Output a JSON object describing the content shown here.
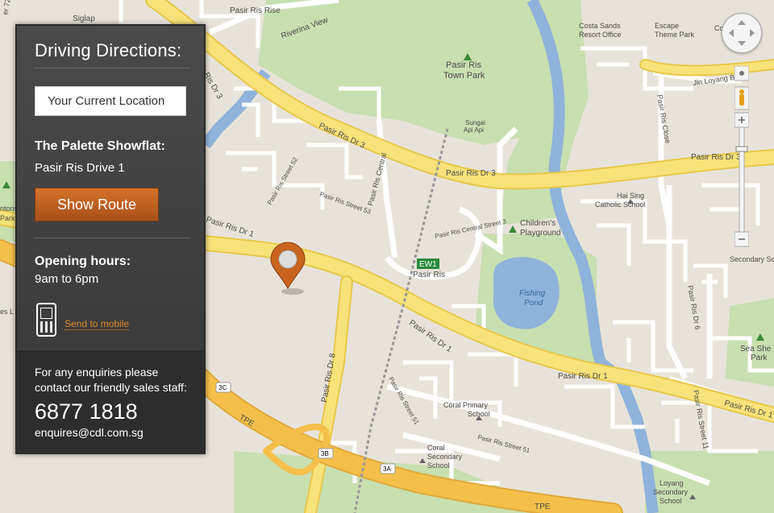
{
  "panel": {
    "title": "Driving Directions:",
    "location_input": "Your Current Location",
    "destination_title": "The Palette Showflat:",
    "destination_address": "Pasir Ris Drive 1",
    "route_button": "Show Route",
    "hours_title": "Opening hours:",
    "hours_value": "9am to 6pm",
    "send_link": "Send to mobile",
    "enquiry_line1": "For any enquiries please",
    "enquiry_line2": "contact our friendly sales staff:",
    "phone": "6877 1818",
    "email": "enquires@cdl.com.sg"
  },
  "map_labels": {
    "siglap": "Siglap",
    "riverina": "Riverina View",
    "pasir_ris_rise": "Pasir Ris Rise",
    "pasir_ris_town_park_1": "Pasir Ris",
    "pasir_ris_town_park_2": "Town Park",
    "sungai_1": "Sungai",
    "sungai_2": "Api Api",
    "costa_1": "Costa Sands",
    "costa_2": "Resort Office",
    "escape_1": "Escape",
    "escape_2": "Theme Park",
    "co": "Co",
    "jln_loyang_besar": "Jln Loyang Besar",
    "pasir_ris_close": "Pasir Ris Close",
    "pasir_ris_dr3_a": "Pasir Ris Dr 3",
    "pasir_ris_dr3_b": "Pasir Ris Dr 3",
    "pasir_ris_dr3_c": "Pasir Ris Dr 3",
    "pasir_ris_st52": "Pasir Ris Street 52",
    "pasir_ris_central": "Pasir Ris Central",
    "pasir_ris_st53": "Pasir Ris Street 53",
    "pasir_ris_central_st3": "Pasir Ris Central Street 3",
    "hai_sing_1": "Hai Sing",
    "hai_sing_2": "Catholic School",
    "childrens_1": "Children's",
    "childrens_2": "Playground",
    "pasir_ris_dr1_a": "Pasir Ris Dr 1",
    "pasir_ris_dr1_b": "Pasir Ris Dr 1",
    "pasir_ris_dr1_c": "Pasir Ris Dr 1",
    "pasir_ris_dr1_d": "Pasir Ris Dr 1",
    "ew1": "EW1",
    "pasir_ris_station": "Pasir Ris",
    "fishing_1": "Fishing",
    "fishing_2": "Pond",
    "pasir_ris_dr6": "Pasir Ris Dr 6",
    "sea_shell_1": "Sea She",
    "sea_shell_2": "Park",
    "secondary_sch": "Secondary Sch",
    "pasir_ris_dr8": "Pasir Ris Dr 8",
    "pasir_ris_st51_a": "Pasir Ris Street 51",
    "pasir_ris_st51_b": "Pasir Ris Street 51",
    "coral_primary_1": "Coral Primary",
    "coral_primary_2": "School",
    "coral_secondary_1": "Coral",
    "coral_secondary_2": "Secondary",
    "coral_secondary_3": "School",
    "pasir_ris_st11": "Pasir Ris Street 11",
    "loyang_1": "Loyang",
    "loyang_2": "Secondary",
    "loyang_3": "School",
    "tpe_a": "TPE",
    "tpe_b": "TPE",
    "exit_3c": "3C",
    "exit_3b": "3B",
    "exit_3a": "3A",
    "er72": "er 72",
    "ontons": "ntons",
    "park_left": "Park",
    "es_l": "es L"
  },
  "colors": {
    "land": "#e8e3da",
    "park": "#c8dfb0",
    "water": "#8fb3db",
    "major_road": "#f8e27a",
    "minor_road": "#ffffff",
    "pin": "#c8641e",
    "button": "#c86a26"
  },
  "icons": [
    "phone-icon",
    "map-pin-icon",
    "pan-control-icon",
    "zoom-in-icon",
    "zoom-out-icon",
    "pegman-icon",
    "mrt-station-icon",
    "school-icon",
    "park-tree-icon"
  ]
}
